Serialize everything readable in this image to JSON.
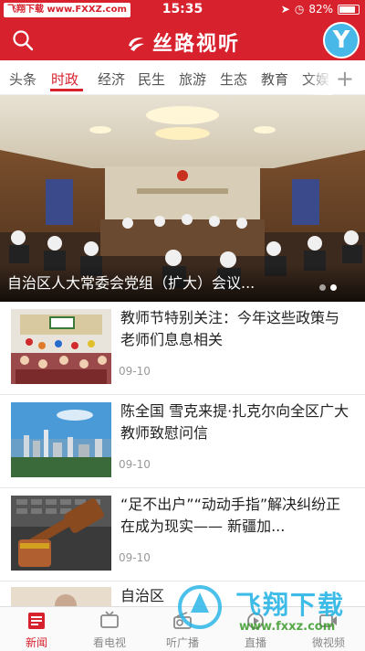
{
  "status_bar": {
    "watermark": "飞翔下载 www.FXXZ.com",
    "time": "15:35",
    "battery": "82%"
  },
  "header": {
    "logo_text": "丝路视听",
    "avatar_letter": "Y"
  },
  "tabs": [
    "头条",
    "时政",
    "经济",
    "民生",
    "旅游",
    "生态",
    "教育",
    "文娱"
  ],
  "active_tab": "时政",
  "banner": {
    "caption": "自治区人大常委会党组（扩大）会议..."
  },
  "news": [
    {
      "title": "教师节特别关注：今年这些政策与老师们息息相关",
      "date": "09-10"
    },
    {
      "title": "陈全国 雪克来提·扎克尔向全区广大教师致慰问信",
      "date": "09-10"
    },
    {
      "title": "“足不出户”“动动手指”解决纠纷正在成为现实—— 新疆加...",
      "date": "09-10"
    },
    {
      "title": "自治区",
      "date": ""
    }
  ],
  "bottom_nav": [
    {
      "label": "新闻",
      "icon": "news-icon"
    },
    {
      "label": "看电视",
      "icon": "tv-icon"
    },
    {
      "label": "听广播",
      "icon": "radio-icon"
    },
    {
      "label": "直播",
      "icon": "live-icon"
    },
    {
      "label": "微视频",
      "icon": "video-icon"
    }
  ],
  "overlay_watermark": {
    "text": "飞翔下载",
    "url": "www.fxxz.com"
  },
  "colors": {
    "brand_red": "#d7222e",
    "accent_blue": "#48b8e8"
  }
}
